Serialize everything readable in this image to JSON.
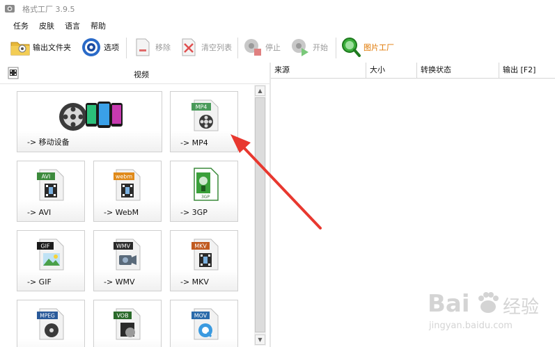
{
  "window": {
    "title": "格式工厂 3.9.5"
  },
  "menu": [
    "任务",
    "皮肤",
    "语言",
    "帮助"
  ],
  "toolbar": {
    "output_folder": "输出文件夹",
    "options": "选项",
    "remove": "移除",
    "clear_list": "清空列表",
    "stop": "停止",
    "start": "开始",
    "picture_factory": "图片工厂"
  },
  "category": {
    "title": "视频"
  },
  "tiles": [
    {
      "label": "-> 移动设备",
      "badge": ""
    },
    {
      "label": "-> MP4",
      "badge": "MP4",
      "badge_color": "#4a9a5a"
    },
    {
      "label": "-> AVI",
      "badge": "AVI",
      "badge_color": "#3c8a3c"
    },
    {
      "label": "-> WebM",
      "badge": "webm",
      "badge_color": "#e08a1a"
    },
    {
      "label": "-> 3GP",
      "badge": "3GP",
      "badge_color": "#3a8a3a"
    },
    {
      "label": "-> GIF",
      "badge": "GIF",
      "badge_color": "#1a1a1a"
    },
    {
      "label": "-> WMV",
      "badge": "WMV",
      "badge_color": "#2a2a2a"
    },
    {
      "label": "-> MKV",
      "badge": "MKV",
      "badge_color": "#c05a20"
    },
    {
      "label": "",
      "badge": "MPEG",
      "badge_color": "#2a5a9a"
    },
    {
      "label": "",
      "badge": "VOB",
      "badge_color": "#2a6a2a"
    },
    {
      "label": "",
      "badge": "MOV",
      "badge_color": "#2a6aaa"
    }
  ],
  "columns": {
    "source": "来源",
    "size": "大小",
    "status": "转换状态",
    "output": "输出 [F2]"
  },
  "watermark": {
    "brand": "Bai",
    "brand2": "经验",
    "url": "jingyan.baidu.com"
  },
  "colors": {
    "annotation_arrow": "#e8382f",
    "accent_orange": "#e07700"
  }
}
